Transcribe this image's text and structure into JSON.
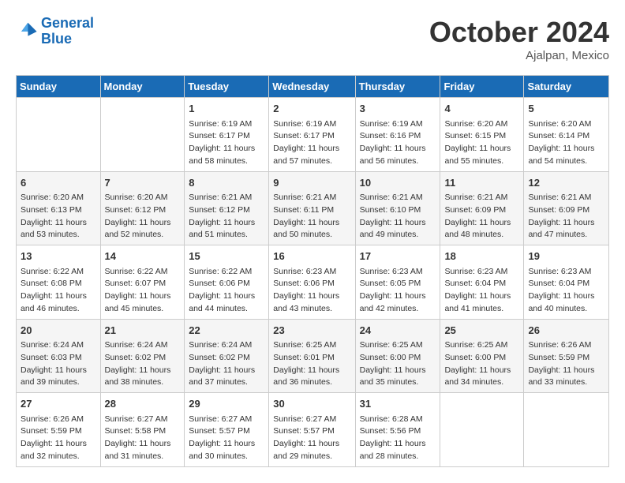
{
  "header": {
    "logo_line1": "General",
    "logo_line2": "Blue",
    "month": "October 2024",
    "location": "Ajalpan, Mexico"
  },
  "days_of_week": [
    "Sunday",
    "Monday",
    "Tuesday",
    "Wednesday",
    "Thursday",
    "Friday",
    "Saturday"
  ],
  "weeks": [
    [
      {
        "num": "",
        "sunrise": "",
        "sunset": "",
        "daylight": ""
      },
      {
        "num": "",
        "sunrise": "",
        "sunset": "",
        "daylight": ""
      },
      {
        "num": "1",
        "sunrise": "Sunrise: 6:19 AM",
        "sunset": "Sunset: 6:17 PM",
        "daylight": "Daylight: 11 hours and 58 minutes."
      },
      {
        "num": "2",
        "sunrise": "Sunrise: 6:19 AM",
        "sunset": "Sunset: 6:17 PM",
        "daylight": "Daylight: 11 hours and 57 minutes."
      },
      {
        "num": "3",
        "sunrise": "Sunrise: 6:19 AM",
        "sunset": "Sunset: 6:16 PM",
        "daylight": "Daylight: 11 hours and 56 minutes."
      },
      {
        "num": "4",
        "sunrise": "Sunrise: 6:20 AM",
        "sunset": "Sunset: 6:15 PM",
        "daylight": "Daylight: 11 hours and 55 minutes."
      },
      {
        "num": "5",
        "sunrise": "Sunrise: 6:20 AM",
        "sunset": "Sunset: 6:14 PM",
        "daylight": "Daylight: 11 hours and 54 minutes."
      }
    ],
    [
      {
        "num": "6",
        "sunrise": "Sunrise: 6:20 AM",
        "sunset": "Sunset: 6:13 PM",
        "daylight": "Daylight: 11 hours and 53 minutes."
      },
      {
        "num": "7",
        "sunrise": "Sunrise: 6:20 AM",
        "sunset": "Sunset: 6:12 PM",
        "daylight": "Daylight: 11 hours and 52 minutes."
      },
      {
        "num": "8",
        "sunrise": "Sunrise: 6:21 AM",
        "sunset": "Sunset: 6:12 PM",
        "daylight": "Daylight: 11 hours and 51 minutes."
      },
      {
        "num": "9",
        "sunrise": "Sunrise: 6:21 AM",
        "sunset": "Sunset: 6:11 PM",
        "daylight": "Daylight: 11 hours and 50 minutes."
      },
      {
        "num": "10",
        "sunrise": "Sunrise: 6:21 AM",
        "sunset": "Sunset: 6:10 PM",
        "daylight": "Daylight: 11 hours and 49 minutes."
      },
      {
        "num": "11",
        "sunrise": "Sunrise: 6:21 AM",
        "sunset": "Sunset: 6:09 PM",
        "daylight": "Daylight: 11 hours and 48 minutes."
      },
      {
        "num": "12",
        "sunrise": "Sunrise: 6:21 AM",
        "sunset": "Sunset: 6:09 PM",
        "daylight": "Daylight: 11 hours and 47 minutes."
      }
    ],
    [
      {
        "num": "13",
        "sunrise": "Sunrise: 6:22 AM",
        "sunset": "Sunset: 6:08 PM",
        "daylight": "Daylight: 11 hours and 46 minutes."
      },
      {
        "num": "14",
        "sunrise": "Sunrise: 6:22 AM",
        "sunset": "Sunset: 6:07 PM",
        "daylight": "Daylight: 11 hours and 45 minutes."
      },
      {
        "num": "15",
        "sunrise": "Sunrise: 6:22 AM",
        "sunset": "Sunset: 6:06 PM",
        "daylight": "Daylight: 11 hours and 44 minutes."
      },
      {
        "num": "16",
        "sunrise": "Sunrise: 6:23 AM",
        "sunset": "Sunset: 6:06 PM",
        "daylight": "Daylight: 11 hours and 43 minutes."
      },
      {
        "num": "17",
        "sunrise": "Sunrise: 6:23 AM",
        "sunset": "Sunset: 6:05 PM",
        "daylight": "Daylight: 11 hours and 42 minutes."
      },
      {
        "num": "18",
        "sunrise": "Sunrise: 6:23 AM",
        "sunset": "Sunset: 6:04 PM",
        "daylight": "Daylight: 11 hours and 41 minutes."
      },
      {
        "num": "19",
        "sunrise": "Sunrise: 6:23 AM",
        "sunset": "Sunset: 6:04 PM",
        "daylight": "Daylight: 11 hours and 40 minutes."
      }
    ],
    [
      {
        "num": "20",
        "sunrise": "Sunrise: 6:24 AM",
        "sunset": "Sunset: 6:03 PM",
        "daylight": "Daylight: 11 hours and 39 minutes."
      },
      {
        "num": "21",
        "sunrise": "Sunrise: 6:24 AM",
        "sunset": "Sunset: 6:02 PM",
        "daylight": "Daylight: 11 hours and 38 minutes."
      },
      {
        "num": "22",
        "sunrise": "Sunrise: 6:24 AM",
        "sunset": "Sunset: 6:02 PM",
        "daylight": "Daylight: 11 hours and 37 minutes."
      },
      {
        "num": "23",
        "sunrise": "Sunrise: 6:25 AM",
        "sunset": "Sunset: 6:01 PM",
        "daylight": "Daylight: 11 hours and 36 minutes."
      },
      {
        "num": "24",
        "sunrise": "Sunrise: 6:25 AM",
        "sunset": "Sunset: 6:00 PM",
        "daylight": "Daylight: 11 hours and 35 minutes."
      },
      {
        "num": "25",
        "sunrise": "Sunrise: 6:25 AM",
        "sunset": "Sunset: 6:00 PM",
        "daylight": "Daylight: 11 hours and 34 minutes."
      },
      {
        "num": "26",
        "sunrise": "Sunrise: 6:26 AM",
        "sunset": "Sunset: 5:59 PM",
        "daylight": "Daylight: 11 hours and 33 minutes."
      }
    ],
    [
      {
        "num": "27",
        "sunrise": "Sunrise: 6:26 AM",
        "sunset": "Sunset: 5:59 PM",
        "daylight": "Daylight: 11 hours and 32 minutes."
      },
      {
        "num": "28",
        "sunrise": "Sunrise: 6:27 AM",
        "sunset": "Sunset: 5:58 PM",
        "daylight": "Daylight: 11 hours and 31 minutes."
      },
      {
        "num": "29",
        "sunrise": "Sunrise: 6:27 AM",
        "sunset": "Sunset: 5:57 PM",
        "daylight": "Daylight: 11 hours and 30 minutes."
      },
      {
        "num": "30",
        "sunrise": "Sunrise: 6:27 AM",
        "sunset": "Sunset: 5:57 PM",
        "daylight": "Daylight: 11 hours and 29 minutes."
      },
      {
        "num": "31",
        "sunrise": "Sunrise: 6:28 AM",
        "sunset": "Sunset: 5:56 PM",
        "daylight": "Daylight: 11 hours and 28 minutes."
      },
      {
        "num": "",
        "sunrise": "",
        "sunset": "",
        "daylight": ""
      },
      {
        "num": "",
        "sunrise": "",
        "sunset": "",
        "daylight": ""
      }
    ]
  ]
}
